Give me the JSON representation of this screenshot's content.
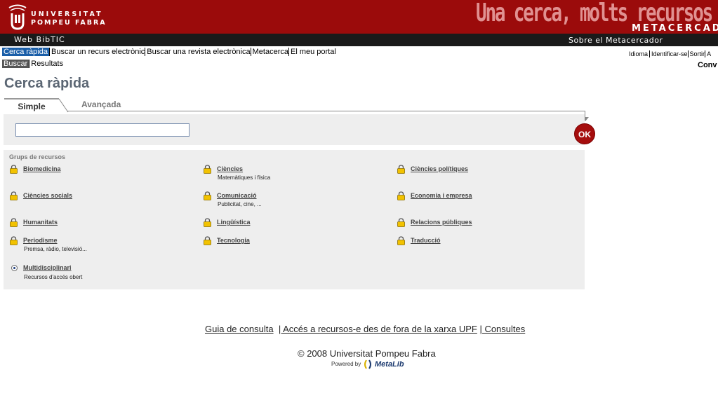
{
  "header": {
    "university_line1": "UNIVERSITAT",
    "university_line2": "POMPEU FABRA",
    "slogan": "Una cerca, molts recursos",
    "meta_word": "METACERCADO",
    "site_name": "Web BibTIC",
    "about": "Sobre el Metacercador"
  },
  "nav": {
    "top": [
      "Cerca ràpida",
      "Buscar un recurs electrònic",
      "Buscar una revista electrònica",
      "Metacerca",
      "El meu portal"
    ],
    "sub": [
      "Buscar",
      "Resultats"
    ],
    "util": [
      "Idioma",
      "Identificar-se",
      "Sortir",
      "A"
    ],
    "conv": "Conv"
  },
  "page": {
    "title": "Cerca ràpida",
    "tabs": [
      "Simple",
      "Avançada"
    ],
    "search_value": "",
    "ok_label": "OK",
    "groups_title": "Grups de recursos"
  },
  "resources": [
    {
      "name": "Biomedicina",
      "desc": ""
    },
    {
      "name": "Ciències",
      "desc": "Matemàtiques i física"
    },
    {
      "name": "Ciències polítiques",
      "desc": ""
    },
    {
      "name": "Ciències socials",
      "desc": ""
    },
    {
      "name": "Comunicació",
      "desc": "Publicitat, cine, ..."
    },
    {
      "name": "Economia i empresa",
      "desc": ""
    },
    {
      "name": "Humanitats",
      "desc": ""
    },
    {
      "name": "Lingüística",
      "desc": ""
    },
    {
      "name": "Relacions públiques",
      "desc": ""
    },
    {
      "name": "Periodisme",
      "desc": "Premsa, ràdio, televisió..."
    },
    {
      "name": "Tecnologia",
      "desc": ""
    },
    {
      "name": "Traducció",
      "desc": ""
    },
    {
      "name": "Multidisciplinari",
      "desc": "Recursos d'accés obert"
    }
  ],
  "footer": {
    "links": [
      "Guia de consulta",
      "| Accés a recursos-e des de fora de la xarxa UPF",
      "| Consultes"
    ],
    "copyright": "© 2008 Universitat Pompeu Fabra",
    "powered_by": "Powered by",
    "metalib": "MetaLib"
  },
  "colors": {
    "brand_red": "#9b0b0b",
    "nav_active": "#1a5ea8",
    "panel": "#eeeeee"
  },
  "icons": [
    "upf-logo",
    "lock-icon",
    "radio-selected-icon",
    "ok-button",
    "metalib-logo"
  ]
}
